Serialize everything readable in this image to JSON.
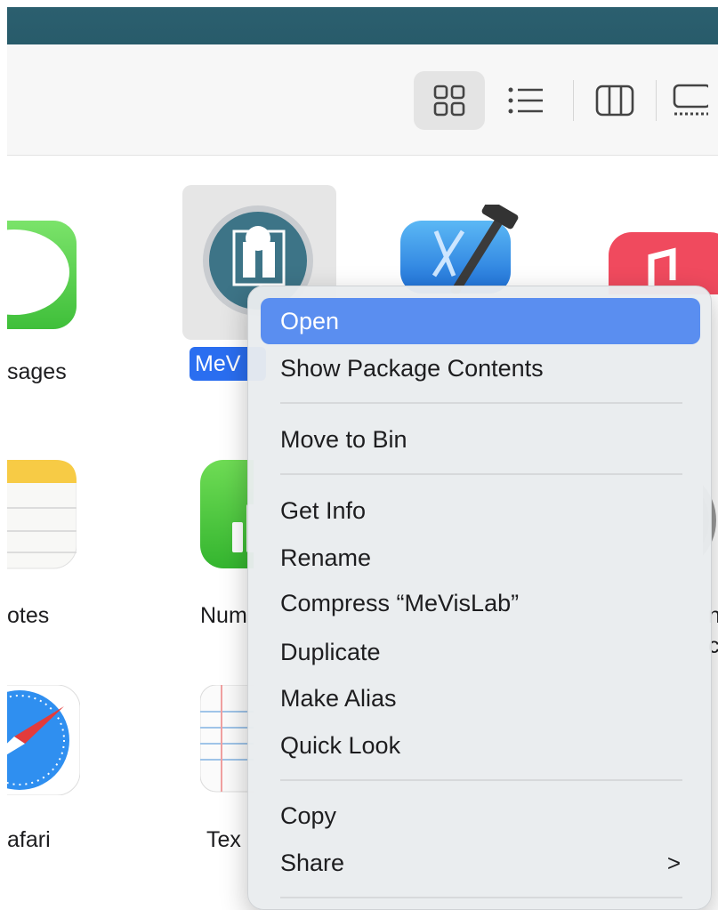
{
  "toolbar": {
    "view_buttons": [
      {
        "name": "icon-view",
        "icon": "grid-icon",
        "active": true
      },
      {
        "name": "list-view",
        "icon": "list-icon",
        "active": false
      },
      {
        "name": "column-view",
        "icon": "columns-icon",
        "active": false
      },
      {
        "name": "gallery-view",
        "icon": "gallery-icon",
        "active": false
      }
    ]
  },
  "apps": {
    "messages": {
      "label": "sages"
    },
    "mevislab": {
      "label": "MeV"
    },
    "notes": {
      "label": "otes"
    },
    "numbers": {
      "label": "Num"
    },
    "safari": {
      "label": "afari"
    },
    "textedit": {
      "label": "Tex"
    },
    "right_partial_1": {
      "label": "n"
    },
    "right_partial_2": {
      "label": "c"
    }
  },
  "context_menu": {
    "items": [
      {
        "label": "Open",
        "highlighted": true
      },
      {
        "label": "Show Package Contents"
      },
      {
        "label": "Move to Bin"
      },
      {
        "label": "Get Info"
      },
      {
        "label": "Rename"
      },
      {
        "label": "Compress “MeVisLab”"
      },
      {
        "label": "Duplicate"
      },
      {
        "label": "Make Alias"
      },
      {
        "label": "Quick Look"
      },
      {
        "label": "Copy"
      },
      {
        "label": "Share",
        "submenu": true,
        "submenu_icon": "chevron-right-icon"
      }
    ],
    "share_chevron": ">"
  },
  "colors": {
    "title_bar": "#2c6070",
    "selection": "#2a6ef0",
    "menu_highlight": "#5a8ef0"
  }
}
